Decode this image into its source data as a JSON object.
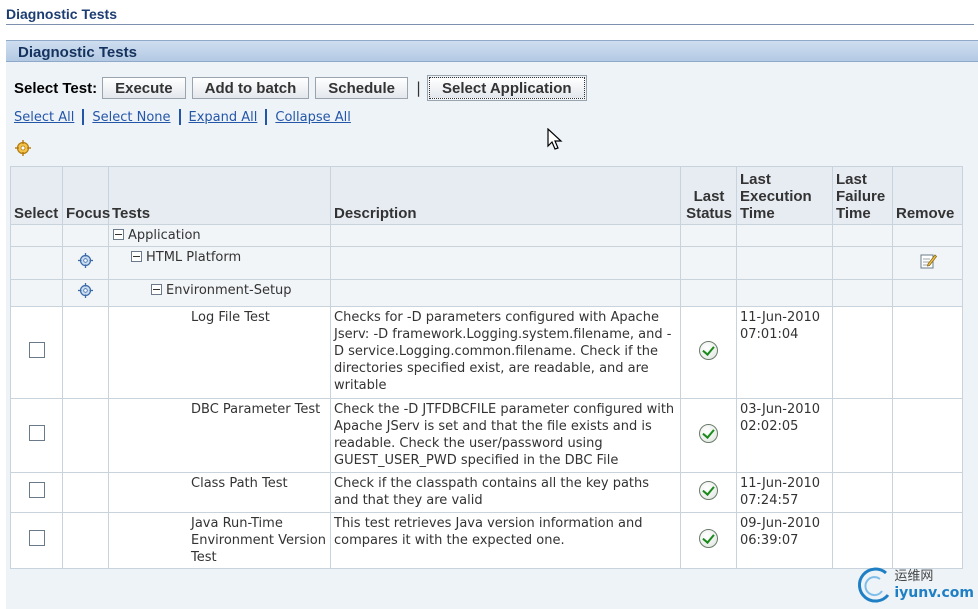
{
  "breadcrumb": {
    "label": "Diagnostic Tests"
  },
  "section": {
    "title": "Diagnostic Tests"
  },
  "toolbar": {
    "label": "Select Test:",
    "buttons": [
      "Execute",
      "Add to batch",
      "Schedule",
      "Select Application"
    ],
    "separator": "|"
  },
  "links": [
    "Select All",
    "Select None",
    "Expand All",
    "Collapse All"
  ],
  "table": {
    "headers": {
      "select": "Select",
      "focus": "Focus",
      "tests": "Tests",
      "description": "Description",
      "last_status": "Last Status",
      "last_execution_time": "Last Execution Time",
      "last_failure_time": "Last Failure Time",
      "remove": "Remove"
    },
    "tree": {
      "application": "Application",
      "html_platform": "HTML Platform",
      "environment_setup": "Environment-Setup"
    },
    "rows": [
      {
        "test": "Log File Test",
        "description": "Checks for -D parameters configured with Apache Jserv: -D framework.Logging.system.filename, and -D service.Logging.common.filename. Check if the directories specified exist, are readable, and are writable",
        "status": "success",
        "exec_date": "11-Jun-2010",
        "exec_time": "07:01:04"
      },
      {
        "test": "DBC Parameter Test",
        "description": "Check the -D JTFDBCFILE parameter configured with Apache JServ is set and that the file exists and is readable. Check the user/password using GUEST_USER_PWD specified in the DBC File",
        "status": "success",
        "exec_date": "03-Jun-2010",
        "exec_time": "02:02:05"
      },
      {
        "test": "Class Path Test",
        "description": "Check if the classpath contains all the key paths and that they are valid",
        "status": "success",
        "exec_date": "11-Jun-2010",
        "exec_time": "07:24:57"
      },
      {
        "test": "Java Run-Time Environment Version Test",
        "description": "This test retrieves Java version information and compares it with the expected one.",
        "status": "success",
        "exec_date": "09-Jun-2010",
        "exec_time": "06:39:07"
      }
    ]
  },
  "watermark": {
    "top": "运维网",
    "bottom": "iyunv.com"
  },
  "colors": {
    "header_bg": "#b3c9e3",
    "link": "#2456a8",
    "title": "#15325e"
  }
}
